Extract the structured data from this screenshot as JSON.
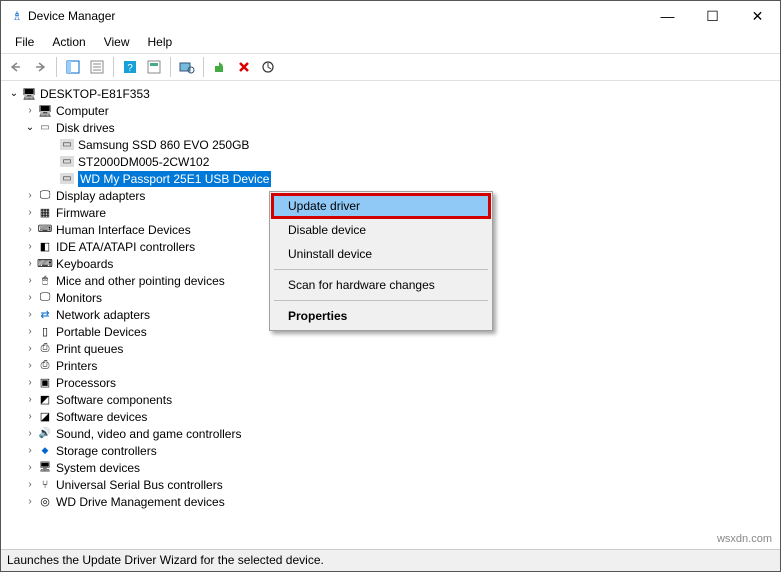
{
  "window": {
    "title": "Device Manager",
    "minimize": "—",
    "maximize": "☐",
    "close": "✕"
  },
  "menu": {
    "file": "File",
    "action": "Action",
    "view": "View",
    "help": "Help"
  },
  "tree": {
    "root": "DESKTOP-E81F353",
    "computer": "Computer",
    "disk_drives": "Disk drives",
    "samsung": "Samsung SSD 860 EVO 250GB",
    "st2000": "ST2000DM005-2CW102",
    "wd": "WD My Passport 25E1 USB Device",
    "display_adapters": "Display adapters",
    "firmware": "Firmware",
    "hid": "Human Interface Devices",
    "ide": "IDE ATA/ATAPI controllers",
    "keyboards": "Keyboards",
    "mice": "Mice and other pointing devices",
    "monitors": "Monitors",
    "network": "Network adapters",
    "portable": "Portable Devices",
    "printq": "Print queues",
    "printers": "Printers",
    "processors": "Processors",
    "swcomp": "Software components",
    "swdev": "Software devices",
    "sound": "Sound, video and game controllers",
    "storage": "Storage controllers",
    "system": "System devices",
    "usb": "Universal Serial Bus controllers",
    "wddrive": "WD Drive Management devices"
  },
  "context_menu": {
    "update": "Update driver",
    "disable": "Disable device",
    "uninstall": "Uninstall device",
    "scan": "Scan for hardware changes",
    "properties": "Properties"
  },
  "status": "Launches the Update Driver Wizard for the selected device.",
  "watermark": "wsxdn.com"
}
